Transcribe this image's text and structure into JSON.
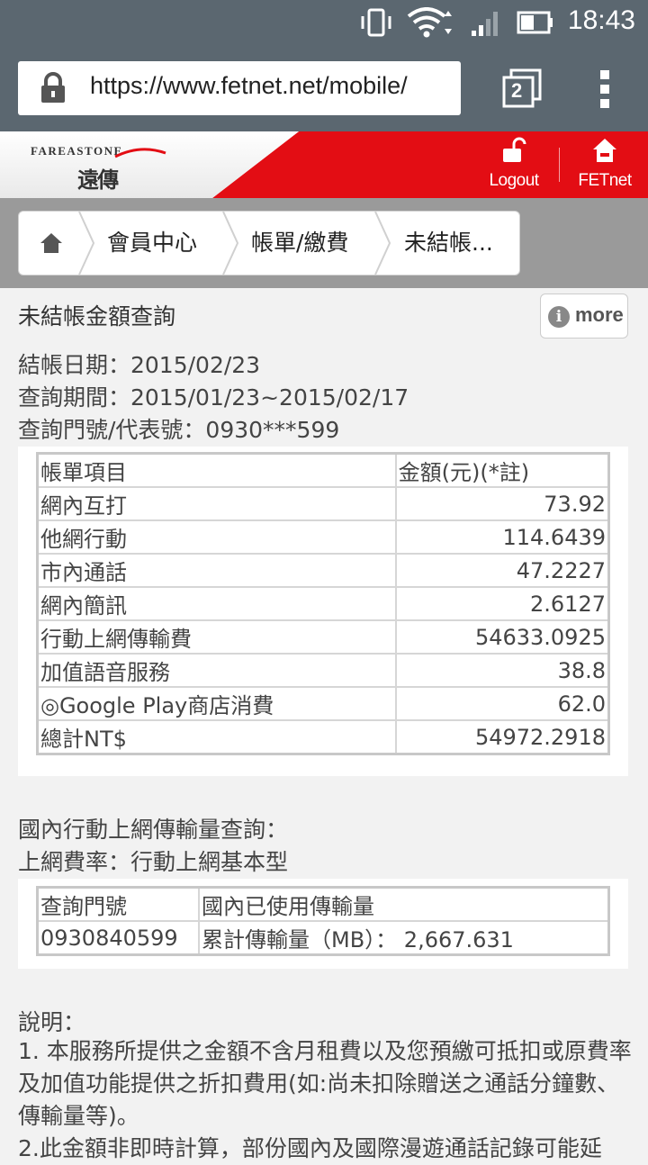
{
  "statusbar": {
    "time": "18:43"
  },
  "browser": {
    "url": "https://www.fetnet.net/mobile/",
    "tab_count": "2"
  },
  "header": {
    "logo_top": "FAREASTONE",
    "logo_bottom": "遠傳",
    "logout_label": "Logout",
    "fetnet_label": "FETnet",
    "brand_color": "#e30d14"
  },
  "breadcrumb": {
    "items": [
      "會員中心",
      "帳單/繳費",
      "未結帳..."
    ]
  },
  "page": {
    "title": "未結帳金額查詢",
    "more_label": "more",
    "info": [
      "結帳日期：2015/02/23",
      "查詢期間：2015/01/23~2015/02/17",
      "查詢門號/代表號：0930***599"
    ]
  },
  "bill_table": {
    "headers": [
      "帳單項目",
      "金額(元)(*註)"
    ],
    "rows": [
      [
        "網內互打",
        "73.92"
      ],
      [
        "他網行動",
        "114.6439"
      ],
      [
        "市內通話",
        "47.2227"
      ],
      [
        "網內簡訊",
        "2.6127"
      ],
      [
        "行動上網傳輸費",
        "54633.0925"
      ],
      [
        "加值語音服務",
        "38.8"
      ],
      [
        "◎Google Play商店消費",
        "62.0"
      ],
      [
        "總計NT$",
        "54972.2918"
      ]
    ]
  },
  "data_query": {
    "title": "國內行動上網傳輸量查詢：",
    "rate": "上網費率：行動上網基本型",
    "headers": [
      "查詢門號",
      "國內已使用傳輸量"
    ],
    "rows": [
      [
        "0930840599",
        "累計傳輸量（MB）： 2,667.631"
      ]
    ]
  },
  "notes": {
    "title": "說明：",
    "items": [
      "1. 本服務所提供之金額不含月租費以及您預繳可抵扣或原費率及加值功能提供之折扣費用(如:尚未扣除贈送之通話分鐘數、傳輸量等)。",
      "2.此金額非即時計算，部份國內及國際漫遊通話記錄可能延"
    ]
  }
}
